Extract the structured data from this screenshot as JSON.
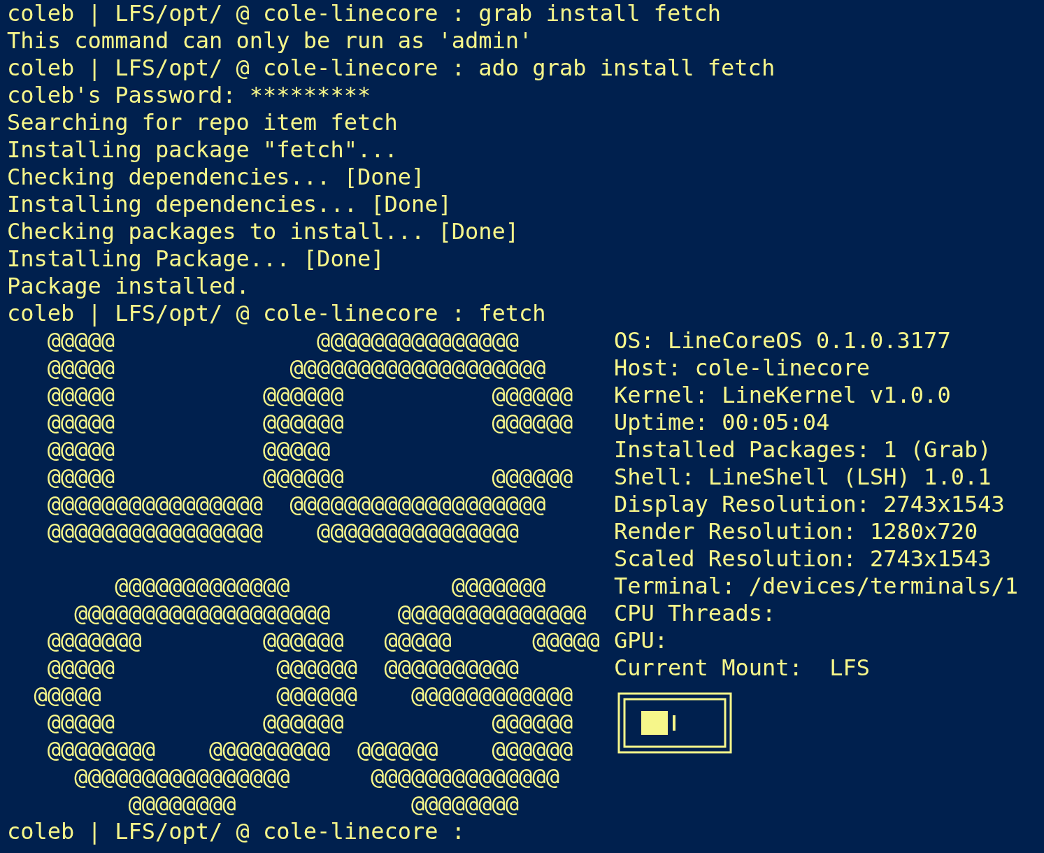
{
  "terminal_lines": [
    "coleb | LFS/opt/ @ cole-linecore : grab install fetch",
    "This command can only be run as 'admin'",
    "coleb | LFS/opt/ @ cole-linecore : ado grab install fetch",
    "coleb's Password: *********",
    "Searching for repo item fetch",
    "Installing package \"fetch\"...",
    "Checking dependencies... [Done]",
    "Installing dependencies... [Done]",
    "Checking packages to install... [Done]",
    "Installing Package... [Done]",
    "Package installed.",
    "coleb | LFS/opt/ @ cole-linecore : fetch"
  ],
  "art_top": [
    "   @@@@@               @@@@@@@@@@@@@@@",
    "   @@@@@             @@@@@@@@@@@@@@@@@@@",
    "   @@@@@           @@@@@@           @@@@@@",
    "   @@@@@           @@@@@@           @@@@@@",
    "   @@@@@           @@@@@",
    "   @@@@@           @@@@@@           @@@@@@",
    "   @@@@@@@@@@@@@@@@  @@@@@@@@@@@@@@@@@@@",
    "   @@@@@@@@@@@@@@@@    @@@@@@@@@@@@@@@"
  ],
  "art_bottom": [
    "        @@@@@@@@@@@@@            @@@@@@@",
    "     @@@@@@@@@@@@@@@@@@@     @@@@@@@@@@@@@@",
    "   @@@@@@@         @@@@@@   @@@@@      @@@@@",
    "   @@@@@            @@@@@@  @@@@@@@@@@",
    "  @@@@@             @@@@@@    @@@@@@@@@@@@",
    "   @@@@@           @@@@@@           @@@@@@",
    "   @@@@@@@@    @@@@@@@@@  @@@@@@    @@@@@@",
    "     @@@@@@@@@@@@@@@@      @@@@@@@@@@@@@@",
    "         @@@@@@@@             @@@@@@@@"
  ],
  "system_info": [
    "OS: LineCoreOS 0.1.0.3177",
    "Host: cole-linecore",
    "Kernel: LineKernel v1.0.0",
    "Uptime: 00:05:04",
    "Installed Packages: 1 (Grab)",
    "Shell: LineShell (LSH) 1.0.1",
    "Display Resolution: 2743x1543",
    "Render Resolution: 1280x720",
    "Scaled Resolution: 2743x1543",
    "Terminal: /devices/terminals/1",
    "CPU Threads:",
    "GPU:",
    "Current Mount:  LFS"
  ],
  "prompt": "coleb | LFS/opt/ @ cole-linecore :"
}
